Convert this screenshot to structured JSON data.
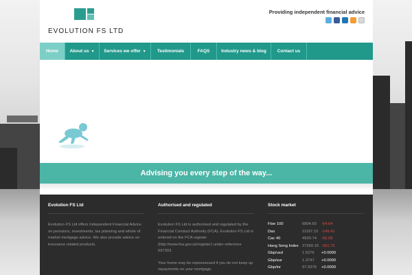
{
  "header": {
    "logo_text": "EVOLUTION FS LTD",
    "tagline": "Providing independent financial advice",
    "social_icons": [
      "twitter-icon",
      "facebook-icon",
      "linkedin-icon",
      "rss-icon",
      "email-icon"
    ]
  },
  "nav": {
    "items": [
      {
        "label": "Home",
        "active": true,
        "dropdown": false
      },
      {
        "label": "About us",
        "active": false,
        "dropdown": true
      },
      {
        "label": "Services we offer",
        "active": false,
        "dropdown": true
      },
      {
        "label": "Testimonials",
        "active": false,
        "dropdown": false
      },
      {
        "label": "FAQS",
        "active": false,
        "dropdown": false
      },
      {
        "label": "Industry news & blog",
        "active": false,
        "dropdown": false
      },
      {
        "label": "Contact us",
        "active": false,
        "dropdown": false
      }
    ]
  },
  "banner": {
    "text": "Advising you every step of the way..."
  },
  "footer": {
    "col1": {
      "title": "Evolution FS Ltd",
      "text": "Evolution FS Ltd offers Independent Financial Advice on pensions, investments, tax planning and whole of market mortgage advice. We also provide advice on insurance related products."
    },
    "col2": {
      "title": "Authorised and regulated",
      "text": "Evolution FS Ltd is authorised and regulated by the Financial Conduct Authority (FCA). Evolution FS Ltd is entered on the FCA register (http://www.fsa.gov.uk/register) under reference 597303.",
      "text2": "Your home may be repossessed if you do not keep up repayments on your mortgage."
    },
    "col3": {
      "title": "Stock market",
      "rows": [
        {
          "name": "Ftse 100",
          "value": "6804.60",
          "change": "-54.64",
          "direction": "neg"
        },
        {
          "name": "Dax",
          "value": "11197.15",
          "change": "-149.41",
          "direction": "neg"
        },
        {
          "name": "Cac 40",
          "value": "4920.74",
          "change": "-56.09",
          "direction": "neg"
        },
        {
          "name": "Hang Seng Index",
          "value": "27260.16",
          "change": "-391.75",
          "direction": "neg"
        },
        {
          "name": "Gbp/usd",
          "value": "1.5276",
          "change": "+0.0000",
          "direction": "pos"
        },
        {
          "name": "Gbp/eur",
          "value": "1.3747",
          "change": "+0.0000",
          "direction": "pos"
        },
        {
          "name": "Gbp/inr",
          "value": "97.9376",
          "change": "+0.0000",
          "direction": "pos"
        }
      ]
    }
  },
  "colors": {
    "accent": "#20998b",
    "nav_active": "#7ccfc6",
    "banner": "#4bb5a6",
    "footer_bg": "#2c2c2c",
    "negative": "#e04848"
  }
}
